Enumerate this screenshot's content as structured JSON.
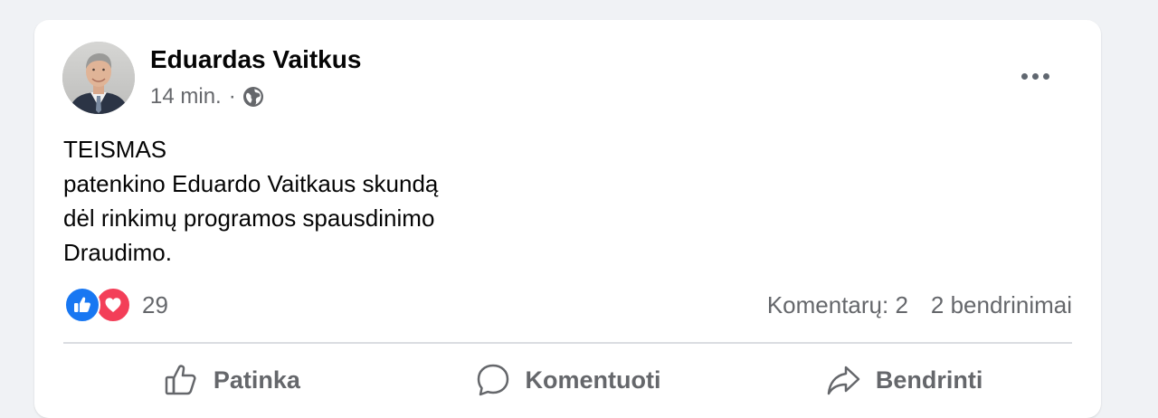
{
  "post": {
    "author": "Eduardas Vaitkus",
    "timestamp": "14 min.",
    "separator": "·",
    "audience_icon": "globe-icon",
    "more_icon": "more-options-icon",
    "text_lines": [
      "TEISMAS",
      "patenkino Eduardo Vaitkaus skundą",
      "dėl rinkimų programos spausdinimo",
      "Draudimo."
    ]
  },
  "reactions": {
    "icons": [
      "like-icon",
      "love-icon"
    ],
    "count": "29",
    "comments": "Komentarų: 2",
    "shares": "2 bendrinimai"
  },
  "actions": {
    "like_label": "Patinka",
    "comment_label": "Komentuoti",
    "share_label": "Bendrinti"
  },
  "colors": {
    "like_blue": "#1877f2",
    "love_red": "#f33e58",
    "secondary_text": "#65676b",
    "primary_text": "#050505"
  }
}
